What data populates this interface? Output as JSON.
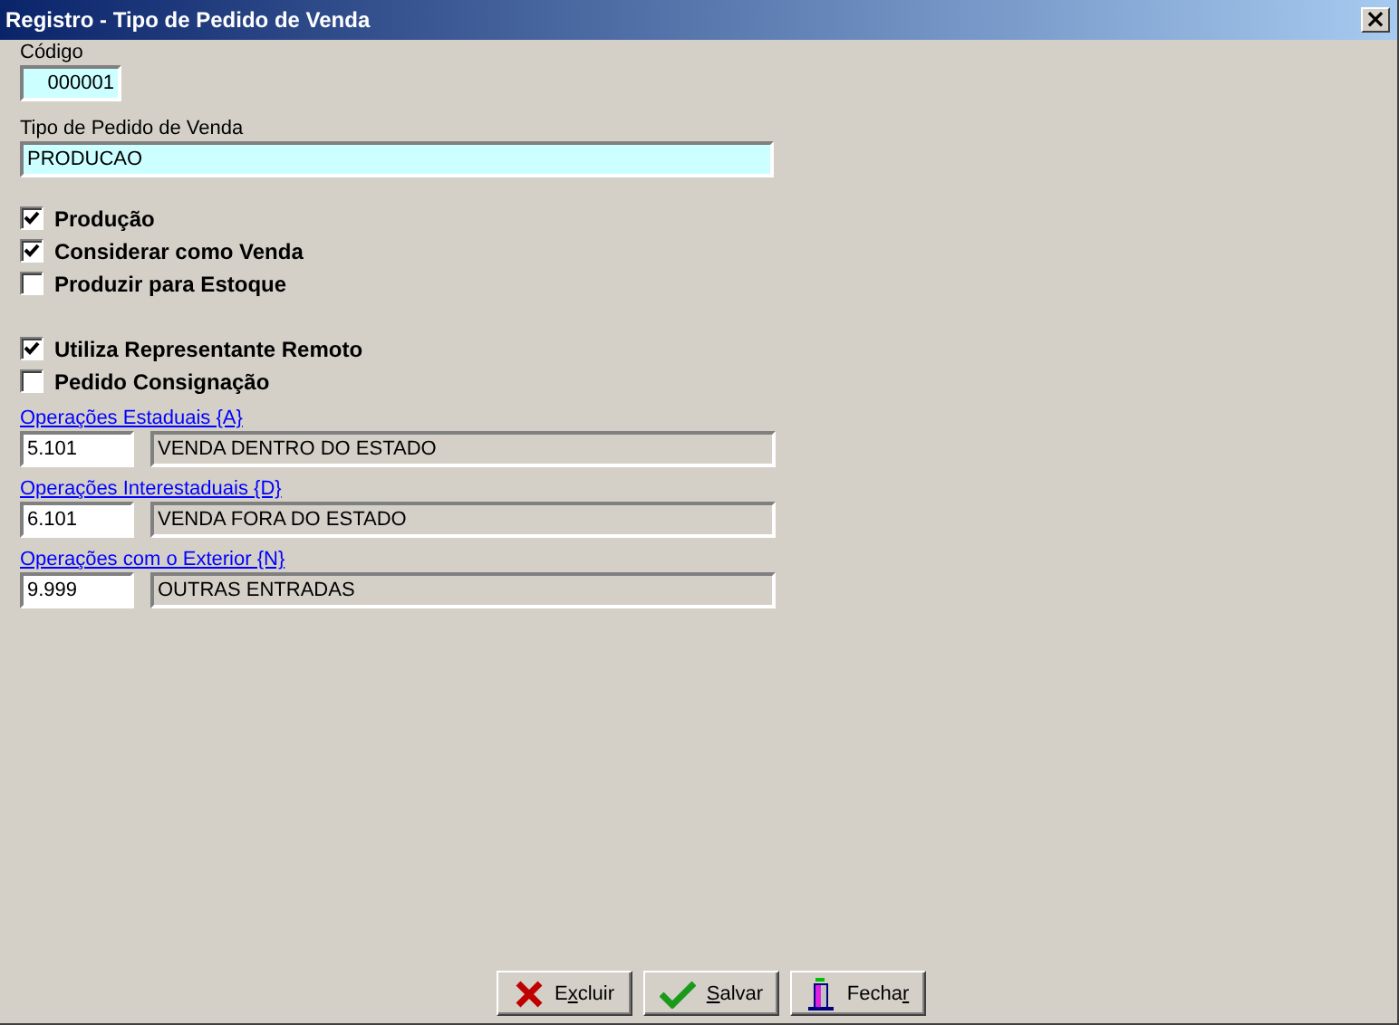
{
  "window": {
    "title": "Registro - Tipo de Pedido de Venda",
    "close": "×"
  },
  "codigo": {
    "label": "Código",
    "value": "000001"
  },
  "tipo": {
    "label": "Tipo de Pedido de Venda",
    "value": "PRODUCAO"
  },
  "checkbox_groups": [
    [
      {
        "label": "Produção",
        "checked": true
      },
      {
        "label": "Considerar como Venda",
        "checked": true
      },
      {
        "label": "Produzir para Estoque",
        "checked": false
      }
    ],
    [
      {
        "label": "Utiliza Representante Remoto",
        "checked": true
      },
      {
        "label": "Pedido Consignação",
        "checked": false
      }
    ]
  ],
  "operations": [
    {
      "link": "Operações Estaduais {A}",
      "code": "5.101",
      "description": "VENDA DENTRO DO ESTADO"
    },
    {
      "link": "Operações Interestaduais {D}",
      "code": "6.101",
      "description": "VENDA FORA DO ESTADO"
    },
    {
      "link": "Operações com o Exterior {N}",
      "code": "9.999",
      "description": "OUTRAS ENTRADAS"
    }
  ],
  "buttons": [
    {
      "kind": "delete",
      "pre": "E",
      "key": "x",
      "post": "cluir"
    },
    {
      "kind": "save",
      "key": "S",
      "post": "alvar"
    },
    {
      "kind": "close",
      "pre": "Fecha",
      "key": "r"
    }
  ]
}
